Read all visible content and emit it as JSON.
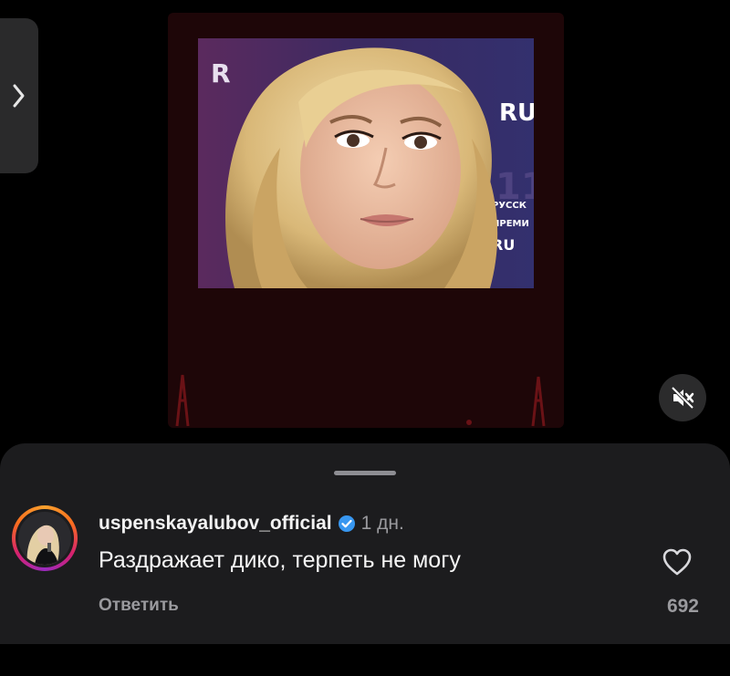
{
  "viewer": {
    "side_nav_icon": "chevron-right-icon",
    "mute_icon": "speaker-muted-icon",
    "photo_backdrop_letters": [
      "R",
      "RU",
      "РУССК",
      "ПРЕМИ",
      "RU"
    ]
  },
  "comment": {
    "username": "uspenskayalubov_official",
    "verified_icon": "verified-badge-icon",
    "timestamp": "1 дн.",
    "text": "Раздражает дико, терпеть не могу",
    "reply_label": "Ответить",
    "like_icon": "heart-outline-icon",
    "like_count": "692"
  },
  "colors": {
    "background": "#000000",
    "sheet": "#1c1c1e",
    "reel_background": "#1e0608",
    "verified": "#3897f0",
    "secondary_text": "#9a9a9e"
  }
}
